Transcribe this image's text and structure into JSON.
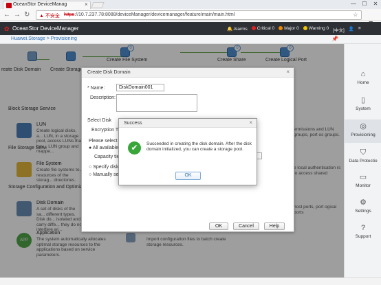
{
  "browser": {
    "tab_title": "OceanStor DeviceManag",
    "tab_close": "×",
    "window_controls": [
      "—",
      "☐",
      "✕"
    ],
    "security_label": "不安全",
    "url_https": "https",
    "url_rest": "://10.7.237.78:8088/deviceManager/devicemanager/feature/main/main.html",
    "star_icon": "☆",
    "menu_icon": "≡"
  },
  "app": {
    "name": "OceanStor DeviceManager",
    "alarms_label": "Alarms",
    "critical": "Critical 0",
    "major": "Major 0",
    "warning": "Warning 0",
    "lang": "[中文]",
    "colors": {
      "critical": "#e02020",
      "major": "#f08a00",
      "warning": "#f2c500"
    }
  },
  "breadcrumb": {
    "text": "Huawei.Storage > Provisioning"
  },
  "flow": {
    "create_disk_domain": "reate Disk Domain",
    "create_storage": "Create Storage",
    "create_file_system": "Create File System",
    "create_share": "Create Share",
    "create_logical_port": "Create Logical Port",
    "badge_1": "0",
    "badge_2": "0",
    "badge_3": "0"
  },
  "sections": {
    "block": "Block Storage Service",
    "file": "File Storage Servi",
    "config": "Storage Configuration and Optimiza"
  },
  "items": {
    "lun_title": "LUN",
    "lun_desc": "Create logical disks, a... LUN, in a storage pool, access LUNs that hav... LUN group and mappe...",
    "lun_desc_right": "ermissions and LUN groups, port os groups.",
    "fs_title": "File System",
    "fs_desc": "Create file systems to... resources of the storag... directories.",
    "fs_desc_right": "e local authentication rs to access shared",
    "dd_title": "Disk Domain",
    "dd_desc": "A set of disks of the sa... different types. Disk do... isolated and carry diffe... they do not interfere wi...",
    "dd_desc_right": "host ports, port ogical ports",
    "app_title": "Application",
    "app_desc": "The system automatically allocates optimal storage resources to the applications based on service parameters.",
    "app_icon_text": "APP",
    "import_desc": "Import configuration files to batch create storage resources."
  },
  "sidebar": [
    {
      "label": "Home",
      "icon": "⌂"
    },
    {
      "label": "System",
      "icon": "▯"
    },
    {
      "label": "Provisioning",
      "icon": "◎"
    },
    {
      "label": "Data Protectio",
      "icon": "⛉"
    },
    {
      "label": "Monitor",
      "icon": "▭"
    },
    {
      "label": "Settings",
      "icon": "⚙"
    },
    {
      "label": "Support",
      "icon": "?"
    }
  ],
  "create_dialog": {
    "title": "Create Disk Domain",
    "close": "×",
    "name_label": "* Name:",
    "name_value": "DiskDomain001",
    "desc_label": "Description:",
    "select_disk": "Select Disk",
    "encryption": "Encryption Typ",
    "please_select": "Please select c",
    "all_available": "All available",
    "capacity": "Capacity tier",
    "specify_disk": "Specify disk",
    "manually_sel": "Manually sel",
    "ok": "OK",
    "cancel": "Cancel",
    "help": "Help"
  },
  "success_dialog": {
    "title": "Success",
    "close": "×",
    "message": "Succeeded in creating the disk domain. After the disk domain initialized, you can create a storage pool.",
    "ok": "OK"
  }
}
